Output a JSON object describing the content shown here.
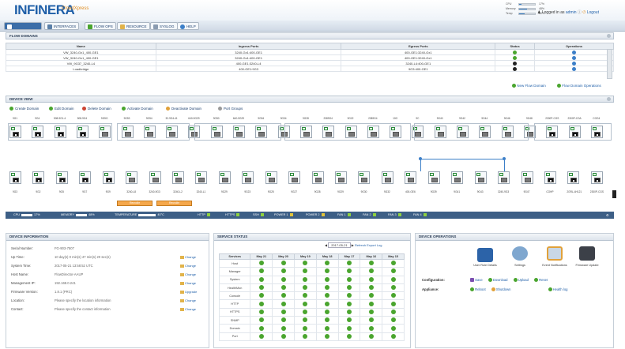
{
  "header": {
    "logo": "INFINERA",
    "subtitle": "CloudXpress",
    "meters": [
      {
        "label": "CPU",
        "value": 0.17,
        "text": "17%"
      },
      {
        "label": "Memory",
        "value": 0.48,
        "text": "48%"
      },
      {
        "label": "Temp",
        "value": 0.35,
        "text": "40°C"
      }
    ],
    "user_text": "Logged in as",
    "user_name": "admin",
    "logout": "Logout"
  },
  "nav": {
    "tabs": [
      "",
      "INTERFACES",
      "FLOW OPS",
      "RESOURCE",
      "SYSLOG",
      "HELP"
    ]
  },
  "flow_domains": {
    "title": "FLOW DOMAINS",
    "columns": [
      "Name",
      "Ingress Ports",
      "Egress Ports",
      "Status",
      "Operations"
    ],
    "rows": [
      {
        "name": "VW_3240-Gx1_400-GE1",
        "ingress": "3240-Gx1:400-GE1",
        "egress": "400-GE1:3240-Gx1",
        "status": "green"
      },
      {
        "name": "VW_3240-Gx1_400-GE1",
        "ingress": "3240-Gx1:400-GE1",
        "egress": "400-GE1:3240-Gx1",
        "status": "green"
      },
      {
        "name": "VW_9G37_3240-L4",
        "ingress": "400-GE1:3240-L4",
        "egress": "3240-L4:400-GE1",
        "status": "black"
      },
      {
        "name": "Loadbridge",
        "ingress": "400-GE1:9G3",
        "egress": "9G3:400-GE1",
        "status": "black"
      }
    ],
    "new_flow": "New Flow Domain",
    "flow_ops": "Flow Domain Operations"
  },
  "device_view": {
    "title": "DEVICE VIEW",
    "tools": [
      "Create Domain",
      "Edit Domain",
      "Delete Domain",
      "Activate Domain",
      "Deactivate Domain",
      "Port Groups"
    ],
    "top_labels": [
      "9G1",
      "9G4",
      "508-9G1-4",
      "508-9G4",
      "9G5G",
      "9G53",
      "9G54",
      "32-9G4-41",
      "640-9G29",
      "9G50",
      "640-9G29",
      "9G54",
      "9G34",
      "9G28",
      "2389G4",
      "9G22",
      "2389G4",
      "10G",
      "9C",
      "9G40",
      "9G42",
      "9G44",
      "9G46",
      "9G48",
      "2300P-CGS",
      "2300P-CGA",
      "CGG4"
    ],
    "bottom_labels": [
      "9G3",
      "9G2",
      "9G5",
      "9G7",
      "9G9",
      "3240-L8",
      "3240-9G3",
      "3240-L2",
      "3240-L1",
      "9G29",
      "9G23",
      "9G25",
      "9G27",
      "9G28",
      "9G29",
      "9G30",
      "9G32",
      "400-GE6",
      "9G39",
      "9G41",
      "9G43",
      "3240-9G3",
      "9G47",
      "CGHP",
      "2GRL-4H121",
      "2300P-CGS"
    ],
    "recvr_labels": [
      "Recvdbr",
      "Recvdbr"
    ]
  },
  "status_bar": {
    "cpu": "CPU",
    "cpu_val": "17%",
    "memory": "MEMORY",
    "mem_val": "48%",
    "temp": "TEMPERATURE",
    "temp_val": "40°C",
    "items": [
      "HTTP",
      "HTTPS",
      "SSH",
      "POWER 1",
      "POWER 2",
      "FAN 1",
      "FAN 2",
      "FAN 3",
      "FAN 4"
    ]
  },
  "device_info": {
    "title": "DEVICE INFORMATION",
    "rows": [
      {
        "k": "Serial Number:",
        "v": "FG-903-7507"
      },
      {
        "k": "Up Time:",
        "v": "10 day(s) 0 min(s) 47 min(s) 20 sec(s)"
      },
      {
        "k": "System Time:",
        "v": "2017-05-21 13:58:52 UTC"
      },
      {
        "k": "Host Name:",
        "v": "FlowDirector-AAUP"
      },
      {
        "k": "Management IP:",
        "v": "192.168.0.241"
      },
      {
        "k": "Firmware Version:",
        "v": "1.8.1 (PRC)"
      },
      {
        "k": "Location:",
        "v": "Please specify the location information"
      },
      {
        "k": "Contact:",
        "v": "Please specify the contact information"
      }
    ],
    "change": [
      "Change",
      "Change",
      "Change",
      "Change",
      "Upgrade",
      "Change",
      "Change"
    ]
  },
  "service_status": {
    "title": "SERVICE STATUS",
    "date": "2017-05-21",
    "refresh": "Refresh",
    "export": "Export Log",
    "columns": [
      "Services",
      "May 21",
      "May 20",
      "May 19",
      "May 18",
      "May 17",
      "May 16",
      "May 15"
    ],
    "rows": [
      "Host",
      "Manager",
      "System",
      "HealthMon",
      "Console",
      "HTTP",
      "HTTPS",
      "SNMP",
      "Domain",
      "Port"
    ]
  },
  "device_ops": {
    "title": "DEVICE OPERATIONS",
    "icons": [
      "User Role Details",
      "Settings",
      "Event Notifications",
      "Firmware Update"
    ],
    "config_label": "Configuration:",
    "config_actions": [
      "Save",
      "Download",
      "Upload",
      "Reset"
    ],
    "appliance_label": "Appliance:",
    "appliance_actions": [
      "Reboot",
      "Shutdown",
      "Health log"
    ]
  }
}
